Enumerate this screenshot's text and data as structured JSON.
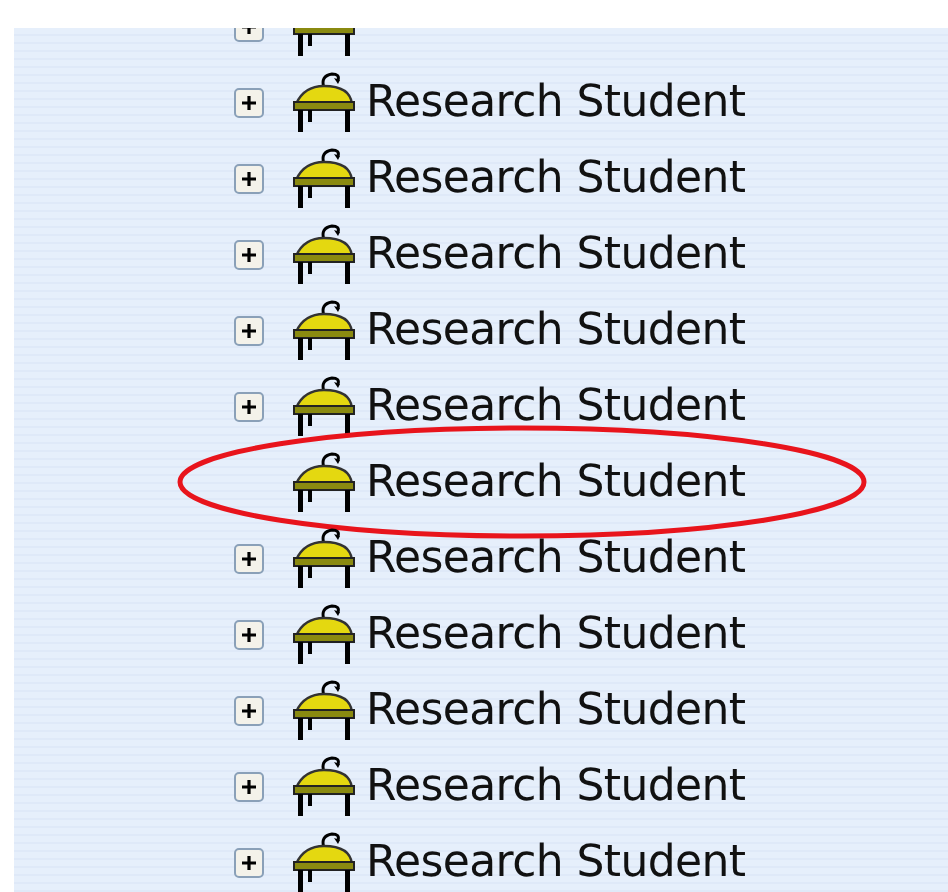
{
  "tree": {
    "items": [
      {
        "expandable": true,
        "circled": false
      },
      {
        "label": "Research Student",
        "expandable": true,
        "circled": false
      },
      {
        "label": "Research Student",
        "expandable": true,
        "circled": false
      },
      {
        "label": "Research Student",
        "expandable": true,
        "circled": false
      },
      {
        "label": "Research Student",
        "expandable": true,
        "circled": false
      },
      {
        "label": "Research Student",
        "expandable": true,
        "circled": false
      },
      {
        "label": "Research Student",
        "expandable": false,
        "circled": true
      },
      {
        "label": "Research Student",
        "expandable": true,
        "circled": false
      },
      {
        "label": "Research Student",
        "expandable": true,
        "circled": false
      },
      {
        "label": "Research Student",
        "expandable": true,
        "circled": false
      },
      {
        "label": "Research Student",
        "expandable": true,
        "circled": false
      },
      {
        "label": "Research Student",
        "expandable": true,
        "circled": false
      }
    ]
  }
}
